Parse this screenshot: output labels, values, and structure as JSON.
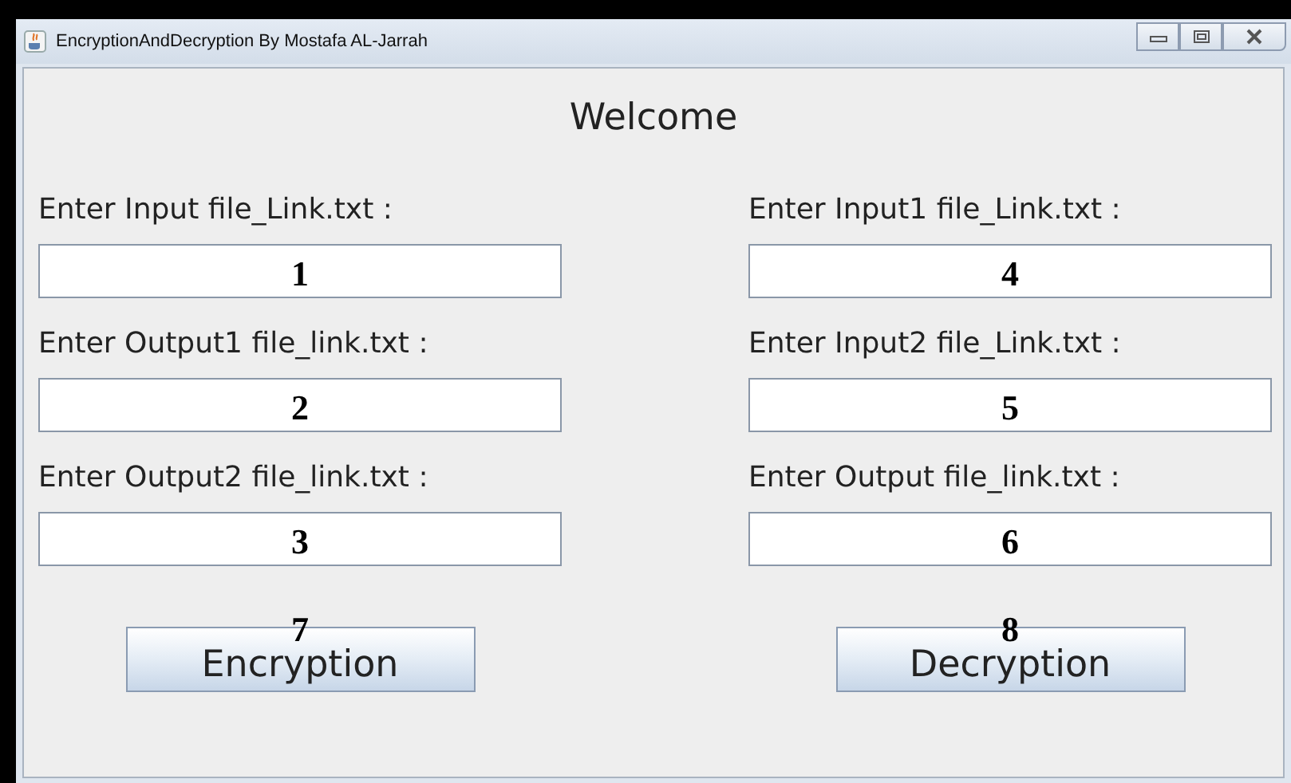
{
  "window": {
    "title": "EncryptionAndDecryption By Mostafa AL-Jarrah"
  },
  "heading": "Welcome",
  "columns": [
    {
      "fields": [
        {
          "label": "Enter Input file_Link.txt :",
          "value": "1"
        },
        {
          "label": "Enter Output1 file_link.txt :",
          "value": "2"
        },
        {
          "label": "Enter Output2 file_link.txt :",
          "value": "3"
        }
      ],
      "button": {
        "label": "Encryption",
        "marker": "7"
      }
    },
    {
      "fields": [
        {
          "label": "Enter Input1 file_Link.txt :",
          "value": "4"
        },
        {
          "label": "Enter Input2 file_Link.txt :",
          "value": "5"
        },
        {
          "label": "Enter Output file_link.txt :",
          "value": "6"
        }
      ],
      "button": {
        "label": "Decryption",
        "marker": "8"
      }
    }
  ]
}
